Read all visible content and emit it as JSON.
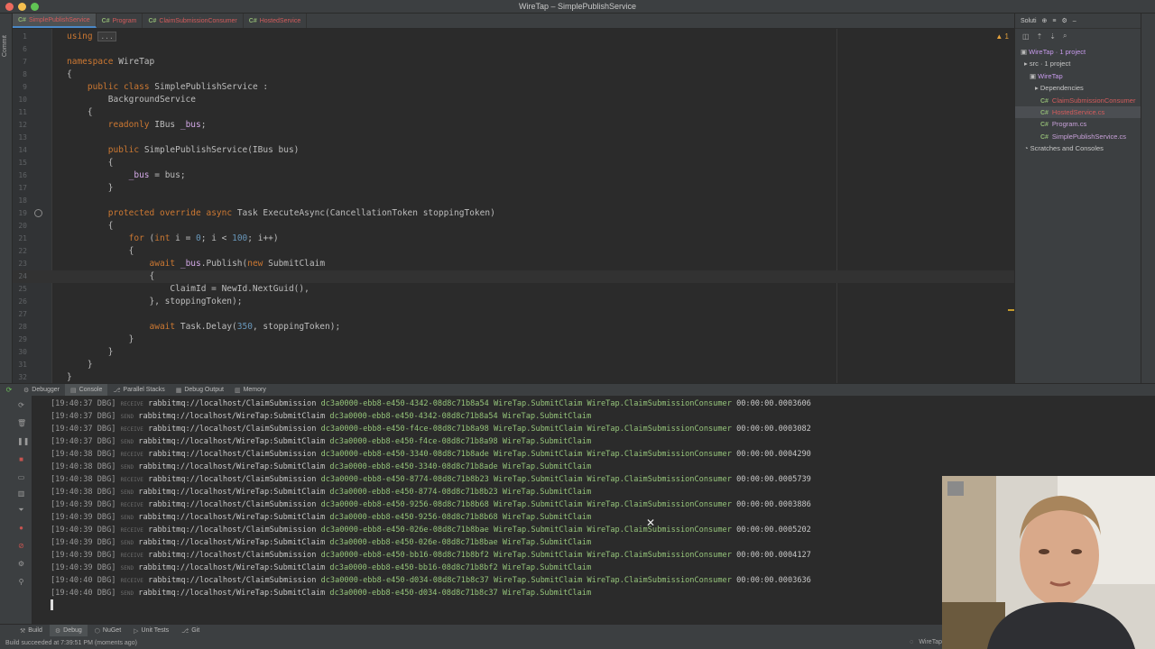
{
  "window": {
    "title": "WireTap – SimplePublishService"
  },
  "left_strip": {
    "label": "Commit"
  },
  "editor_tabs": [
    {
      "label": "SimplePublishService",
      "active": true
    },
    {
      "label": "Program",
      "active": false
    },
    {
      "label": "ClaimSubmissionConsumer",
      "active": false
    },
    {
      "label": "HostedService",
      "active": false
    }
  ],
  "editor": {
    "lines": [
      {
        "n": "1",
        "text": "using ..."
      },
      {
        "n": "6",
        "text": ""
      },
      {
        "n": "7",
        "text": "namespace WireTap"
      },
      {
        "n": "8",
        "text": "{"
      },
      {
        "n": "9",
        "text": "    public class SimplePublishService :"
      },
      {
        "n": "10",
        "text": "        BackgroundService"
      },
      {
        "n": "11",
        "text": "    {"
      },
      {
        "n": "12",
        "text": "        readonly IBus _bus;"
      },
      {
        "n": "13",
        "text": ""
      },
      {
        "n": "14",
        "text": "        public SimplePublishService(IBus bus)"
      },
      {
        "n": "15",
        "text": "        {"
      },
      {
        "n": "16",
        "text": "            _bus = bus;"
      },
      {
        "n": "17",
        "text": "        }"
      },
      {
        "n": "18",
        "text": ""
      },
      {
        "n": "19",
        "text": "        protected override async Task ExecuteAsync(CancellationToken stoppingToken)"
      },
      {
        "n": "20",
        "text": "        {"
      },
      {
        "n": "21",
        "text": "            for (int i = 0; i < 100; i++)"
      },
      {
        "n": "22",
        "text": "            {"
      },
      {
        "n": "23",
        "text": "                await _bus.Publish(new SubmitClaim"
      },
      {
        "n": "24",
        "text": "                {"
      },
      {
        "n": "25",
        "text": "                    ClaimId = NewId.NextGuid(),"
      },
      {
        "n": "26",
        "text": "                }, stoppingToken);"
      },
      {
        "n": "27",
        "text": ""
      },
      {
        "n": "28",
        "text": "                await Task.Delay(350, stoppingToken);"
      },
      {
        "n": "29",
        "text": "            }"
      },
      {
        "n": "30",
        "text": "        }"
      },
      {
        "n": "31",
        "text": "    }"
      },
      {
        "n": "32",
        "text": "}"
      }
    ],
    "current_line": "24",
    "warning_badge": "1"
  },
  "solution": {
    "header": "Soluti",
    "items": [
      {
        "label": "WireTap · 1 project",
        "type": "solution"
      },
      {
        "label": "src · 1 project",
        "type": "folder"
      },
      {
        "label": "WireTap",
        "type": "project"
      },
      {
        "label": "Dependencies",
        "type": "deps"
      },
      {
        "label": "ClaimSubmissionConsumer",
        "type": "cs"
      },
      {
        "label": "HostedService.cs",
        "type": "cs"
      },
      {
        "label": "Program.cs",
        "type": "cs"
      },
      {
        "label": "SimplePublishService.cs",
        "type": "cs"
      },
      {
        "label": "Scratches and Consoles",
        "type": "scratch"
      }
    ],
    "selected": "HostedService.cs"
  },
  "debug_tabs": [
    {
      "label": "Debugger",
      "active": false
    },
    {
      "label": "Console",
      "active": true
    },
    {
      "label": "Parallel Stacks",
      "active": false
    },
    {
      "label": "Debug Output",
      "active": false
    },
    {
      "label": "Memory",
      "active": false
    }
  ],
  "console": {
    "lines": [
      {
        "ts": "[19:40:37 DBG]",
        "tag": "RECEIVE",
        "uri": "rabbitmq://localhost/ClaimSubmission",
        "body": "dc3a0000-ebb8-e450-4342-08d8c71b8a54 WireTap.SubmitClaim WireTap.ClaimSubmissionConsumer",
        "dur": "00:00:00.0003606"
      },
      {
        "ts": "[19:40:37 DBG]",
        "tag": "SEND",
        "uri": "rabbitmq://localhost/WireTap:SubmitClaim",
        "body": "dc3a0000-ebb8-e450-4342-08d8c71b8a54 WireTap.SubmitClaim",
        "dur": ""
      },
      {
        "ts": "[19:40:37 DBG]",
        "tag": "RECEIVE",
        "uri": "rabbitmq://localhost/ClaimSubmission",
        "body": "dc3a0000-ebb8-e450-f4ce-08d8c71b8a98 WireTap.SubmitClaim WireTap.ClaimSubmissionConsumer",
        "dur": "00:00:00.0003082"
      },
      {
        "ts": "[19:40:37 DBG]",
        "tag": "SEND",
        "uri": "rabbitmq://localhost/WireTap:SubmitClaim",
        "body": "dc3a0000-ebb8-e450-f4ce-08d8c71b8a98 WireTap.SubmitClaim",
        "dur": ""
      },
      {
        "ts": "[19:40:38 DBG]",
        "tag": "RECEIVE",
        "uri": "rabbitmq://localhost/ClaimSubmission",
        "body": "dc3a0000-ebb8-e450-3340-08d8c71b8ade WireTap.SubmitClaim WireTap.ClaimSubmissionConsumer",
        "dur": "00:00:00.0004290"
      },
      {
        "ts": "[19:40:38 DBG]",
        "tag": "SEND",
        "uri": "rabbitmq://localhost/WireTap:SubmitClaim",
        "body": "dc3a0000-ebb8-e450-3340-08d8c71b8ade WireTap.SubmitClaim",
        "dur": ""
      },
      {
        "ts": "[19:40:38 DBG]",
        "tag": "RECEIVE",
        "uri": "rabbitmq://localhost/ClaimSubmission",
        "body": "dc3a0000-ebb8-e450-8774-08d8c71b8b23 WireTap.SubmitClaim WireTap.ClaimSubmissionConsumer",
        "dur": "00:00:00.0005739"
      },
      {
        "ts": "[19:40:38 DBG]",
        "tag": "SEND",
        "uri": "rabbitmq://localhost/WireTap:SubmitClaim",
        "body": "dc3a0000-ebb8-e450-8774-08d8c71b8b23 WireTap.SubmitClaim",
        "dur": ""
      },
      {
        "ts": "[19:40:39 DBG]",
        "tag": "RECEIVE",
        "uri": "rabbitmq://localhost/ClaimSubmission",
        "body": "dc3a0000-ebb8-e450-9256-08d8c71b8b68 WireTap.SubmitClaim WireTap.ClaimSubmissionConsumer",
        "dur": "00:00:00.0003886"
      },
      {
        "ts": "[19:40:39 DBG]",
        "tag": "SEND",
        "uri": "rabbitmq://localhost/WireTap:SubmitClaim",
        "body": "dc3a0000-ebb8-e450-9256-08d8c71b8b68 WireTap.SubmitClaim",
        "dur": ""
      },
      {
        "ts": "[19:40:39 DBG]",
        "tag": "RECEIVE",
        "uri": "rabbitmq://localhost/ClaimSubmission",
        "body": "dc3a0000-ebb8-e450-026e-08d8c71b8bae WireTap.SubmitClaim WireTap.ClaimSubmissionConsumer",
        "dur": "00:00:00.0005202"
      },
      {
        "ts": "[19:40:39 DBG]",
        "tag": "SEND",
        "uri": "rabbitmq://localhost/WireTap:SubmitClaim",
        "body": "dc3a0000-ebb8-e450-026e-08d8c71b8bae WireTap.SubmitClaim",
        "dur": ""
      },
      {
        "ts": "[19:40:39 DBG]",
        "tag": "RECEIVE",
        "uri": "rabbitmq://localhost/ClaimSubmission",
        "body": "dc3a0000-ebb8-e450-bb16-08d8c71b8bf2 WireTap.SubmitClaim WireTap.ClaimSubmissionConsumer",
        "dur": "00:00:00.0004127"
      },
      {
        "ts": "[19:40:39 DBG]",
        "tag": "SEND",
        "uri": "rabbitmq://localhost/WireTap:SubmitClaim",
        "body": "dc3a0000-ebb8-e450-bb16-08d8c71b8bf2 WireTap.SubmitClaim",
        "dur": ""
      },
      {
        "ts": "[19:40:40 DBG]",
        "tag": "RECEIVE",
        "uri": "rabbitmq://localhost/ClaimSubmission",
        "body": "dc3a0000-ebb8-e450-d034-08d8c71b8c37 WireTap.SubmitClaim WireTap.ClaimSubmissionConsumer",
        "dur": "00:00:00.0003636"
      },
      {
        "ts": "[19:40:40 DBG]",
        "tag": "SEND",
        "uri": "rabbitmq://localhost/WireTap:SubmitClaim",
        "body": "dc3a0000-ebb8-e450-d034-08d8c71b8c37 WireTap.SubmitClaim",
        "dur": ""
      }
    ]
  },
  "bottom_tabs": [
    {
      "label": "Build",
      "active": false
    },
    {
      "label": "Debug",
      "active": true
    },
    {
      "label": "NuGet",
      "active": false
    },
    {
      "label": "Unit Tests",
      "active": false
    },
    {
      "label": "Git",
      "active": false
    }
  ],
  "status": {
    "message": "Build succeeded at 7:39:51 PM (moments ago)",
    "right": "WireTap"
  },
  "colors": {
    "bg": "#2b2b2b",
    "panel": "#3c3f41",
    "keyword": "#cc7832",
    "log_body": "#95c47a",
    "tab_error": "#d35c5c",
    "accent": "#4a88c7"
  }
}
